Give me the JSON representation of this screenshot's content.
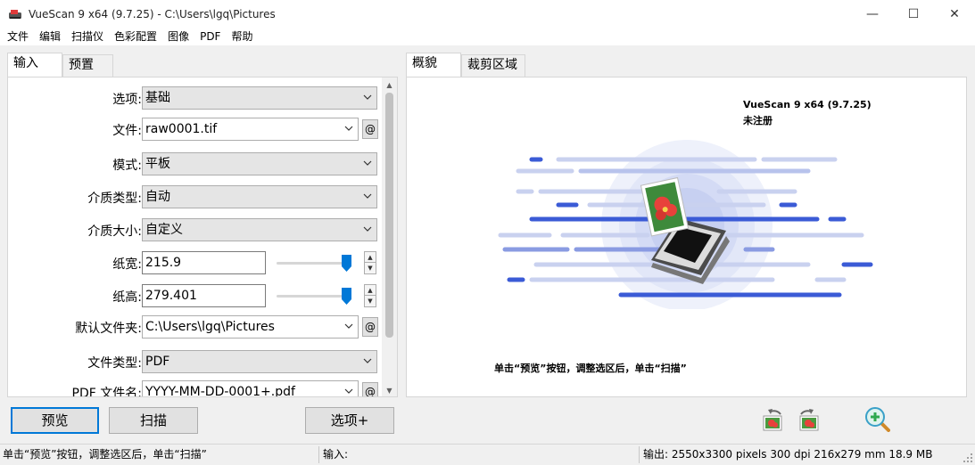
{
  "window": {
    "title": "VueScan 9 x64 (9.7.25) - C:\\Users\\lgq\\Pictures",
    "minimize": "—",
    "maximize": "☐",
    "close": "✕"
  },
  "menu": [
    "文件",
    "编辑",
    "扫描仪",
    "色彩配置",
    "图像",
    "PDF",
    "帮助"
  ],
  "left_tabs": [
    "输入",
    "预置"
  ],
  "right_tabs": [
    "概貌",
    "裁剪区域"
  ],
  "form": {
    "options": {
      "label": "选项:",
      "value": "基础"
    },
    "file": {
      "label": "文件:",
      "value": "raw0001.tif",
      "at": "@"
    },
    "mode": {
      "label": "模式:",
      "value": "平板"
    },
    "media_type": {
      "label": "介质类型:",
      "value": "自动"
    },
    "media_size": {
      "label": "介质大小:",
      "value": "自定义"
    },
    "paper_width": {
      "label": "纸宽:",
      "value": "215.9"
    },
    "paper_height": {
      "label": "纸高:",
      "value": "279.401"
    },
    "default_folder": {
      "label": "默认文件夹:",
      "value": "C:\\Users\\lgq\\Pictures",
      "at": "@"
    },
    "file_type": {
      "label": "文件类型:",
      "value": "PDF"
    },
    "pdf_filename": {
      "label": "PDF 文件名:",
      "value": "YYYY-MM-DD-0001+.pdf",
      "at": "@"
    }
  },
  "preview": {
    "app_name": "VueScan 9 x64 (9.7.25)",
    "registration": "未注册",
    "hint": "单击“预览”按钮，调整选区后，单击“扫描”"
  },
  "buttons": {
    "preview": "预览",
    "scan": "扫描",
    "options": "选项+"
  },
  "status": {
    "left": "单击“预览”按钮，调整选区后，单击“扫描”",
    "input": "输入:",
    "output": "输出: 2550x3300 pixels 300 dpi 216x279 mm 18.9 MB"
  },
  "colors": {
    "accent": "#0078d7",
    "illustration_blue": "#3b5bd6"
  }
}
